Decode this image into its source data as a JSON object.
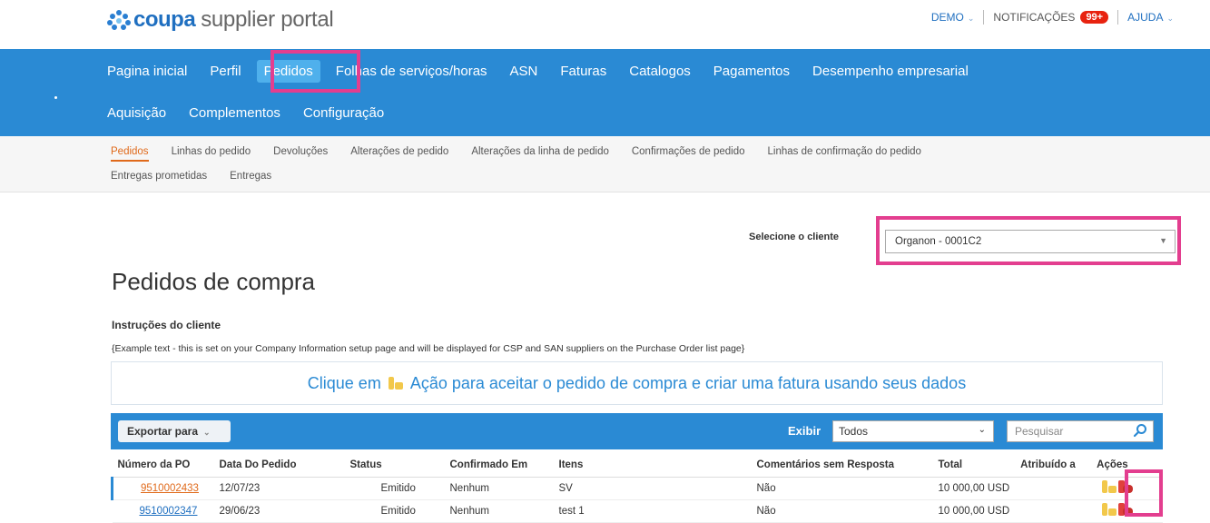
{
  "header": {
    "logo_brand": "coupa",
    "logo_text": "supplier portal",
    "user": "DEMO",
    "notifications_label": "NOTIFICAÇÕES",
    "notifications_count": "99+",
    "help": "AJUDA"
  },
  "nav": {
    "row1": [
      "Pagina inicial",
      "Perfil",
      "Pedidos",
      "Folhas de serviços/horas",
      "ASN",
      "Faturas",
      "Catalogos",
      "Pagamentos",
      "Desempenho empresarial"
    ],
    "row2": [
      "Aquisição",
      "Complementos",
      "Configuração"
    ],
    "active": "Pedidos"
  },
  "subnav": {
    "row1": [
      "Pedidos",
      "Linhas do pedido",
      "Devoluções",
      "Alterações de pedido",
      "Alterações da linha de pedido",
      "Confirmações de pedido",
      "Linhas de confirmação do pedido"
    ],
    "row2": [
      "Entregas prometidas",
      "Entregas"
    ],
    "active": "Pedidos"
  },
  "client": {
    "label": "Selecione o cliente",
    "selected": "Organon - 0001C2"
  },
  "page": {
    "title": "Pedidos de compra",
    "instructions_title": "Instruções do cliente",
    "instructions_text": "{Example text - this is set on your Company Information setup page and will be displayed for CSP and SAN suppliers on the Purchase Order list page}",
    "banner_before": "Clique em",
    "banner_after": "Ação para aceitar o pedido de compra e criar uma fatura usando seus dados"
  },
  "toolbar": {
    "export_label": "Exportar para",
    "view_label": "Exibir",
    "view_value": "Todos",
    "search_placeholder": "Pesquisar"
  },
  "table": {
    "headers": [
      "Número da PO",
      "Data Do Pedido",
      "Status",
      "Confirmado Em",
      "Itens",
      "Comentários sem Resposta",
      "Total",
      "Atribuído a",
      "Ações"
    ],
    "rows": [
      {
        "po": "9510002433",
        "date": "12/07/23",
        "status": "Emitido",
        "confirmed": "Nenhum",
        "items": "SV",
        "comments": "Não",
        "total": "10 000,00 USD",
        "assigned": ""
      },
      {
        "po": "9510002347",
        "date": "29/06/23",
        "status": "Emitido",
        "confirmed": "Nenhum",
        "items": "test 1",
        "comments": "Não",
        "total": "10 000,00 USD",
        "assigned": ""
      }
    ]
  },
  "colors": {
    "nav_blue": "#2a8ad4",
    "active_orange": "#e06a1b",
    "highlight_pink": "#e33e8f",
    "badge_red": "#e8220f"
  }
}
